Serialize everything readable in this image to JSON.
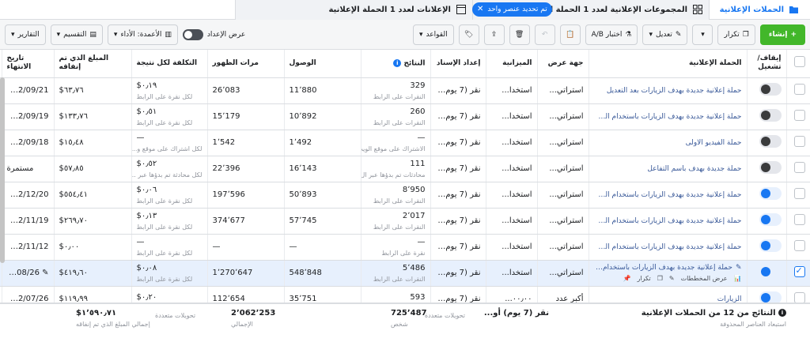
{
  "tabs": {
    "campaigns": "الحملات الإعلانية",
    "adsets": "المجموعات الإعلانية لعدد 1 الحملة الإعلانية",
    "selection_pill": "تم تحديد عنصر واحد",
    "ads": "الإعلانات لعدد 1 الحملة الإعلانية"
  },
  "toolbar": {
    "create": "إنشاء",
    "duplicate": "تكرار",
    "edit": "تعديل",
    "ab_test": "اختبار A/B",
    "rules": "القواعد",
    "view_setup": "عرض الإعداد",
    "columns": "الأعمدة: الأداء",
    "breakdown": "التقسيم",
    "reports": "التقارير"
  },
  "columns": {
    "onoff": "إيقاف/ تشغيل",
    "campaign": "الحملة الإعلانية",
    "delivery": "جهة عرض",
    "budget": "الميزانية",
    "attribution": "إعداد الإسناد",
    "results": "النتائج",
    "reach": "الوصول",
    "impressions": "مرات الظهور",
    "cost_per_result": "التكلفة لكل نتيجة",
    "amount_spent": "المبلغ الذي تم إنفاقه",
    "ends": "تاريخ الانتهاء"
  },
  "rows": [
    {
      "toggle": "off",
      "selected": false,
      "name": "حملة إعلانية جديدة بهدف الزيارات بعد التعديل",
      "delivery": "استراتي...",
      "budget": "استخدا...",
      "attribution": "نقر (7 يوم) أو...",
      "results": "329",
      "results_sub": "النقرات على الرابط",
      "reach": "11٬880",
      "impressions": "26٬083",
      "cpr": "٠٫١٩$",
      "cpr_sub": "لكل نقرة على الرابط",
      "spent": "٦٣٫٧٦$",
      "ends": "2022/09/21"
    },
    {
      "toggle": "off",
      "selected": false,
      "name": "حملة إعلانية جديدة بهدف الزيارات باستخدام الستوري...",
      "delivery": "استراتي...",
      "budget": "استخدا...",
      "attribution": "نقر (7 يوم) أو...",
      "results": "260",
      "results_sub": "النقرات على الرابط",
      "reach": "10٬892",
      "impressions": "15٬179",
      "cpr": "٠٫٥١$",
      "cpr_sub": "لكل نقرة على الرابط",
      "spent": "١٣٣٫٧٦$",
      "ends": "2022/09/19"
    },
    {
      "toggle": "off",
      "selected": false,
      "name": "حملة الفيديو الاولى",
      "delivery": "استراتي...",
      "budget": "استخدا...",
      "attribution": "نقر (7 يوم) أو...",
      "results": "—",
      "results_sub": "الاشتراك على موقع الويب",
      "reach": "1٬492",
      "impressions": "1٬542",
      "cpr": "—",
      "cpr_sub": "لكل اشتراك على موقع و...",
      "spent": "١٥٫٤٨$",
      "ends": "2022/09/18"
    },
    {
      "toggle": "off",
      "selected": false,
      "name": "حملة جديدة بهدف باسم التفاعل",
      "delivery": "استراتي...",
      "budget": "استخدا...",
      "attribution": "نقر (7 يوم) أو...",
      "results": "111",
      "results_sub": "محادثات تم بدؤها عبر ال...",
      "reach": "16٬143",
      "impressions": "22٬396",
      "cpr": "٠٫٥٢$",
      "cpr_sub": "لكل محادثة تم بدؤها عبر ...",
      "spent": "٥٧٫٨٥$",
      "ends": "مستمرة"
    },
    {
      "toggle": "on",
      "selected": false,
      "name": "حملة إعلانية جديدة بهدف الزيارات باستخدام الستوري...",
      "delivery": "استراتي...",
      "budget": "استخدا...",
      "attribution": "نقر (7 يوم) أو...",
      "results": "8٬950",
      "results_sub": "النقرات على الرابط",
      "reach": "50٬893",
      "impressions": "197٬596",
      "cpr": "٠٫٠٦$",
      "cpr_sub": "لكل نقرة على الرابط",
      "spent": "٥٥٤٫٤١$",
      "ends": "2022/12/20"
    },
    {
      "toggle": "on",
      "selected": false,
      "name": "حملة إعلانية جديدة بهدف الزيارات باستخدام الستوري...",
      "delivery": "استراتي...",
      "budget": "استخدا...",
      "attribution": "نقر (7 يوم) أو...",
      "results": "2٬017",
      "results_sub": "النقرات على الرابط",
      "reach": "57٬745",
      "impressions": "374٬677",
      "cpr": "٠٫١٣$",
      "cpr_sub": "لكل نقرة على الرابط",
      "spent": "٢٦٩٫٧٠$",
      "ends": "2022/11/19"
    },
    {
      "toggle": "on",
      "selected": false,
      "name": "حملة إعلانية جديدة بهدف الزيارات باستخدام الستوري",
      "delivery": "استراتي...",
      "budget": "استخدا...",
      "attribution": "نقر (7 يوم) أو...",
      "results": "—",
      "results_sub": "نقرة على الرابط",
      "reach": "—",
      "impressions": "—",
      "cpr": "—",
      "cpr_sub": "لكل نقرة على الرابط",
      "spent": "٠٫٠٠$",
      "ends": "2022/11/12"
    },
    {
      "toggle": "on",
      "selected": true,
      "name": "حملة إعلانية جديدة بهدف الزيارات باستخدام الستوري",
      "delivery": "استراتي...",
      "budget": "استخدا...",
      "attribution": "نقر (7 يوم) أو...",
      "results": "5٬486",
      "results_sub": "النقرات على الرابط",
      "reach": "548٬848",
      "impressions": "1٬270٬647",
      "cpr": "٠٫٠٨$",
      "cpr_sub": "لكل نقرة على الرابط",
      "spent": "٤١٩٫٦٠$",
      "ends": "2/08/26...",
      "tools_view": "عرض المخططات",
      "tools_dup": "تكرار"
    },
    {
      "toggle": "on",
      "selected": false,
      "name": "الزيارات",
      "delivery": "أكبر عدد",
      "budget": "٠٠٫٠٠...",
      "attribution": "نقر (7 يوم) أو...",
      "results": "593",
      "results_sub": "",
      "reach": "35٬751",
      "impressions": "112٬654",
      "cpr": "٠٫٢٠$",
      "cpr_sub": "",
      "spent": "١١٩٫٩٩$",
      "ends": "2022/07/26"
    }
  ],
  "footer": {
    "title": "النتائج من 12 من الحملات الإعلانية",
    "title_sub": "استبعاد العناصر المحذوفة",
    "attribution": "نقر (7 يوم) أو...",
    "results_sub": "تحويلات متعددة",
    "reach": "725٬487",
    "reach_sub": "شخص",
    "impressions": "2٬062٬253",
    "impressions_sub": "الإجمالي",
    "cpr_sub": "تحويلات متعددة",
    "spent": "١٬٥٩٠٫٧١$",
    "spent_sub": "إجمالي المبلغ الذي تم إنفاقه"
  },
  "colors": {
    "accent": "#1877f2",
    "create": "#42b72a",
    "selected_row": "#e7f0fd"
  }
}
